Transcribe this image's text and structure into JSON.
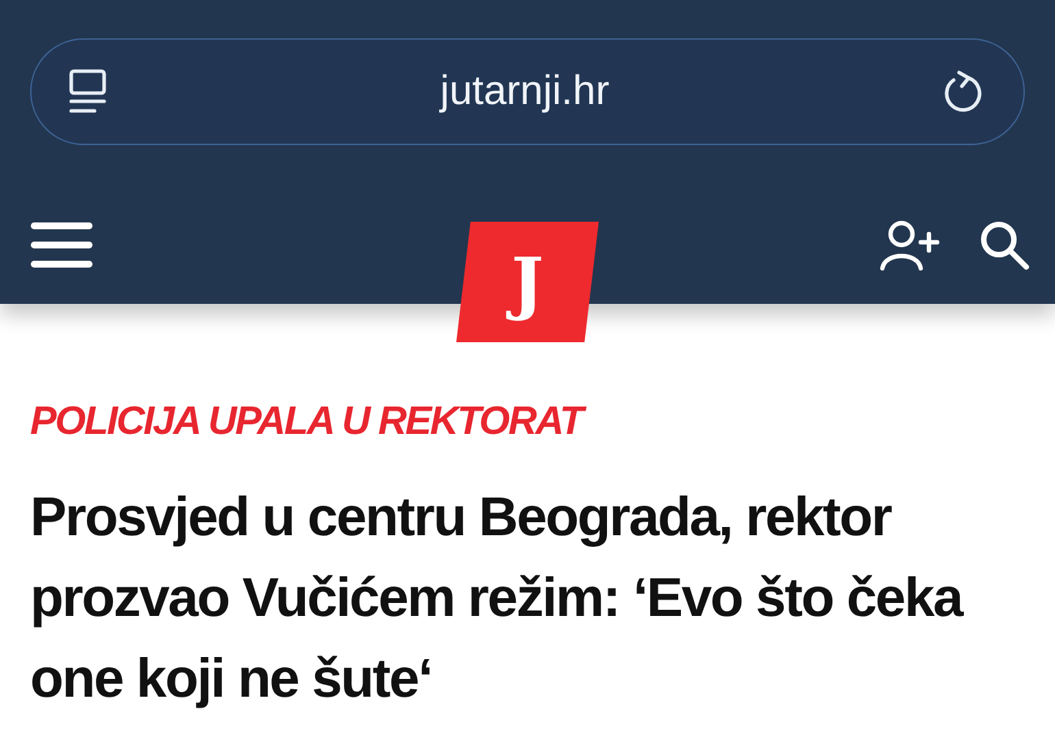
{
  "browser": {
    "address": "jutarnji.hr"
  },
  "site_header": {
    "logo": "J"
  },
  "article": {
    "kicker": "POLICIJA UPALA U REKTORAT",
    "headline": "Prosvjed u centru Beograda, rektor prozvao Vučićem režim: ‘Evo što čeka one koji ne šute‘"
  }
}
